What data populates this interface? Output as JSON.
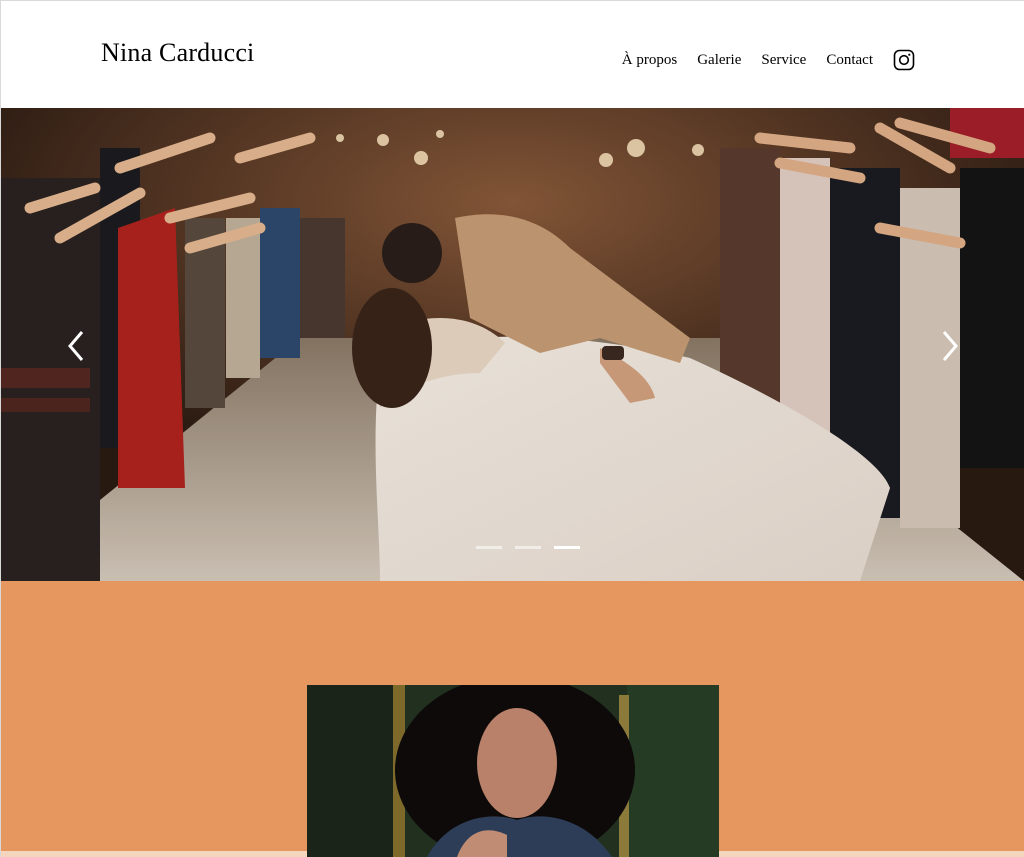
{
  "header": {
    "brand": "Nina Carducci",
    "nav": [
      "À propos",
      "Galerie",
      "Service",
      "Contact"
    ],
    "instagram_icon": "instagram-icon"
  },
  "carousel": {
    "prev_icon": "chevron-left-icon",
    "next_icon": "chevron-right-icon",
    "slide_count": 3,
    "active_slide": 3
  },
  "colors": {
    "accent": "#e6965f",
    "accent_light": "#f4d6bf",
    "header_bg": "#ffffff"
  }
}
